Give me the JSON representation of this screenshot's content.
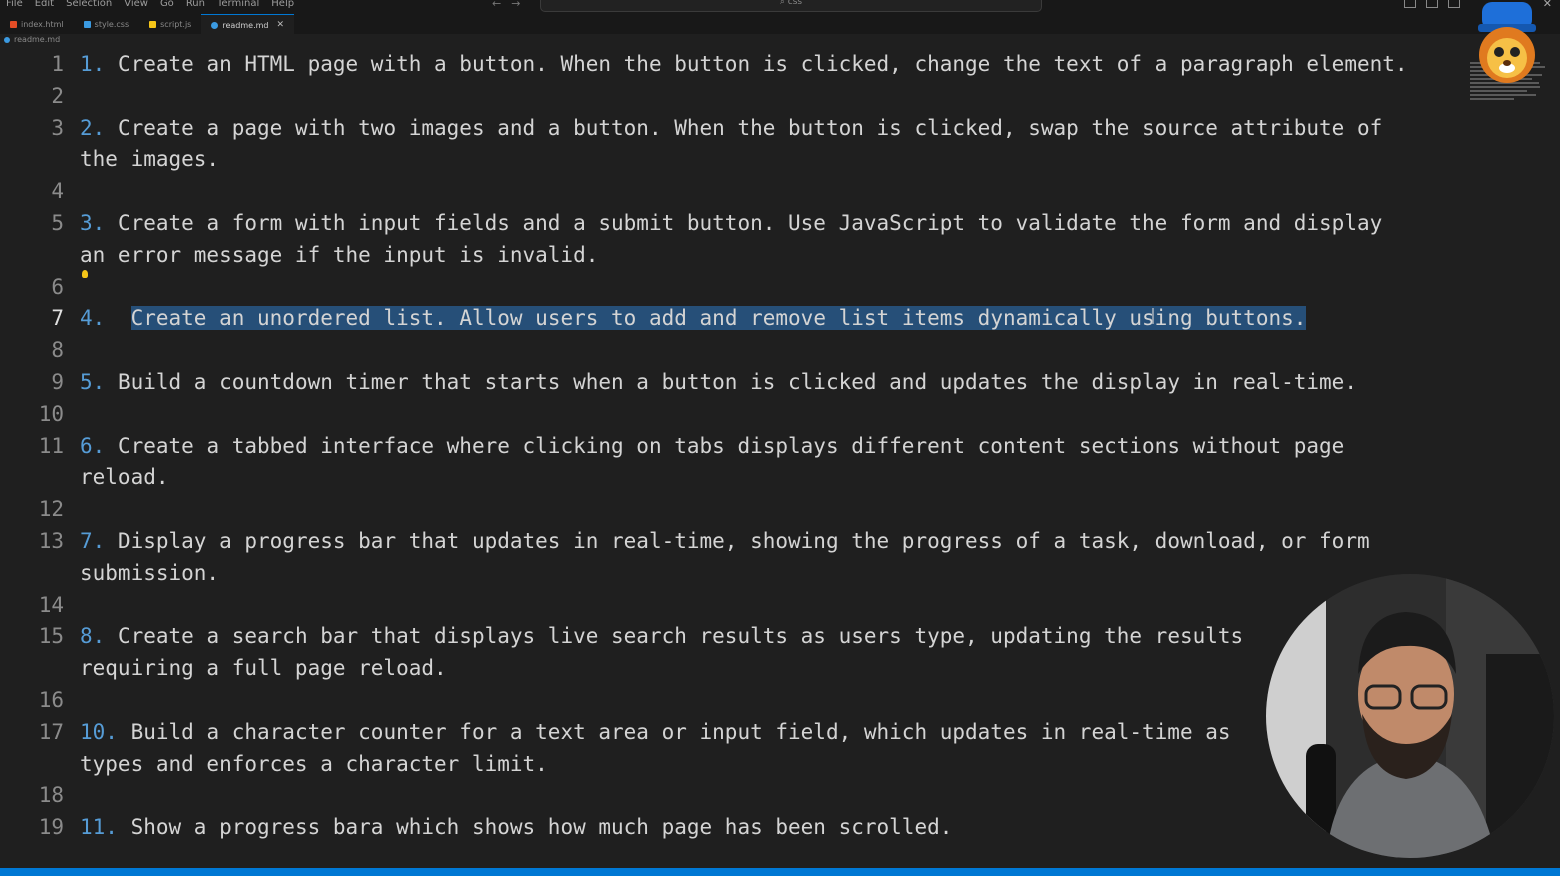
{
  "menu": {
    "items": [
      "File",
      "Edit",
      "Selection",
      "View",
      "Go",
      "Run",
      "Terminal",
      "Help"
    ],
    "command_center_text": "css"
  },
  "tabs": [
    {
      "label": "index.html",
      "icon": "html-file-icon",
      "color": "#e44d26",
      "active": false
    },
    {
      "label": "style.css",
      "icon": "css-file-icon",
      "color": "#3b9ae1",
      "active": false
    },
    {
      "label": "script.js",
      "icon": "js-file-icon",
      "color": "#f5c518",
      "active": false
    },
    {
      "label": "readme.md",
      "icon": "markdown-file-icon",
      "color": "#3b9ae1",
      "active": true
    }
  ],
  "breadcrumb": {
    "file": "readme.md"
  },
  "editor": {
    "current_line": 7,
    "lines": [
      {
        "n": "1",
        "num": "1.",
        "text": " Create an HTML page with a button. When the button is clicked, change the text of a paragraph element."
      },
      {
        "n": "2",
        "num": "",
        "text": ""
      },
      {
        "n": "3",
        "num": "2.",
        "text": " Create a page with two images and a button. When the button is clicked, swap the source attribute of",
        "wrap": "the images."
      },
      {
        "n": "4",
        "num": "",
        "text": ""
      },
      {
        "n": "5",
        "num": "3.",
        "text": " Create a form with input fields and a submit button. Use JavaScript to validate the form and display",
        "wrap": "an error message if the input is invalid."
      },
      {
        "n": "6",
        "num": "",
        "text": ""
      },
      {
        "n": "7",
        "num": "4.",
        "text": "Create an unordered list. Allow users to add and remove list items dynamically using buttons.",
        "selected": true
      },
      {
        "n": "8",
        "num": "",
        "text": ""
      },
      {
        "n": "9",
        "num": "5.",
        "text": " Build a countdown timer that starts when a button is clicked and updates the display in real-time."
      },
      {
        "n": "10",
        "num": "",
        "text": ""
      },
      {
        "n": "11",
        "num": "6.",
        "text": " Create a tabbed interface where clicking on tabs displays different content sections without page",
        "wrap": "reload."
      },
      {
        "n": "12",
        "num": "",
        "text": ""
      },
      {
        "n": "13",
        "num": "7.",
        "text": " Display a progress bar that updates in real-time, showing the progress of a task, download, or form",
        "wrap": "submission."
      },
      {
        "n": "14",
        "num": "",
        "text": ""
      },
      {
        "n": "15",
        "num": "8.",
        "text": " Create a search bar that displays live search results as users type, updating the results",
        "wrap": "requiring a full page reload."
      },
      {
        "n": "16",
        "num": "",
        "text": ""
      },
      {
        "n": "17",
        "num": "10.",
        "text": " Build a character counter for a text area or input field, which updates in real-time as",
        "wrap": "types and enforces a character limit."
      },
      {
        "n": "18",
        "num": "",
        "text": ""
      },
      {
        "n": "19",
        "num": "11.",
        "text": " Show a progress bara which shows how much page has been scrolled."
      }
    ]
  },
  "colors": {
    "background": "#1f1f1f",
    "list_number": "#569cd6",
    "selection": "#264f78",
    "status_bar": "#0078d4"
  }
}
